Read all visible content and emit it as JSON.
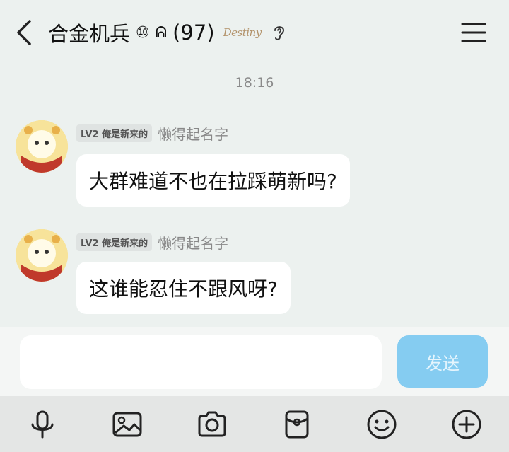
{
  "header": {
    "back_icon": "chevron-left-icon",
    "group_name": "合金机兵",
    "badge": "⑩",
    "signal_glyph": "ᕱ",
    "member_count": "(97)",
    "logo_text": "Destiny",
    "ear_icon": "ear-icon",
    "menu_icon": "hamburger-menu-icon"
  },
  "timestamp": "18:16",
  "messages": [
    {
      "level": "LV2 俺是新来的",
      "nickname": "懒得起名字",
      "text": "大群难道不也在拉踩萌新吗?"
    },
    {
      "level": "LV2 俺是新来的",
      "nickname": "懒得起名字",
      "text": "这谁能忍住不跟风呀?"
    }
  ],
  "input": {
    "value": "",
    "placeholder": "",
    "send_label": "发送"
  },
  "toolbar": {
    "items": [
      "microphone-icon",
      "image-icon",
      "camera-icon",
      "red-packet-icon",
      "emoji-icon",
      "plus-icon"
    ]
  },
  "colors": {
    "background": "#ecf1ef",
    "send_button": "#85ccf1",
    "bubble": "#ffffff",
    "toolbar": "#e4e6e5"
  }
}
